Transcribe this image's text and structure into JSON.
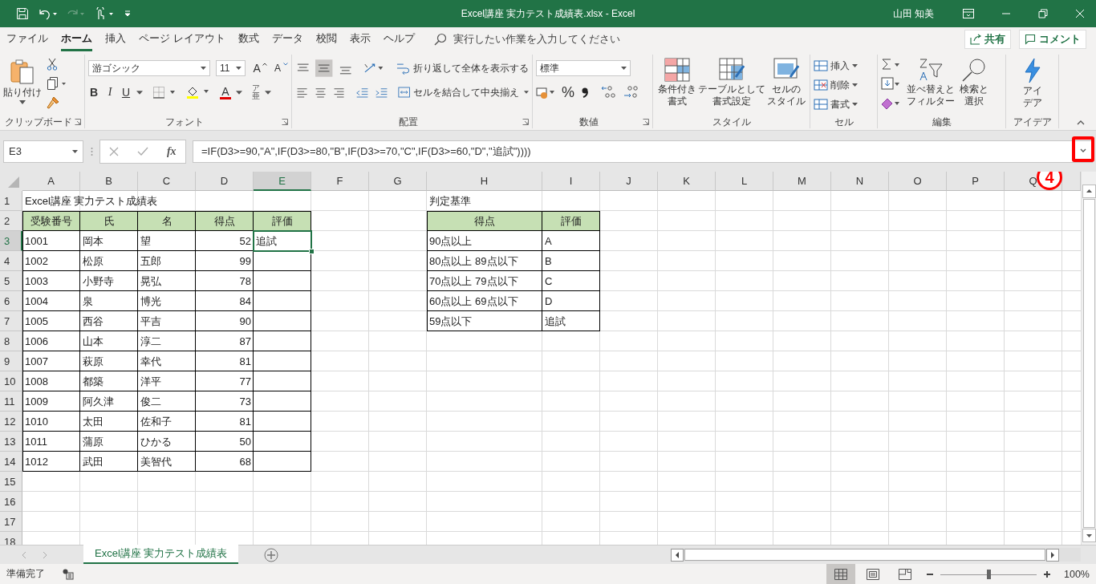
{
  "title_bar": {
    "title": "Excel講座 実力テスト成績表.xlsx  -  Excel",
    "user": "山田 知美"
  },
  "menu": {
    "tabs": [
      {
        "label": "ファイル",
        "selected": false
      },
      {
        "label": "ホーム",
        "selected": true
      },
      {
        "label": "挿入",
        "selected": false
      },
      {
        "label": "ページ レイアウト",
        "selected": false
      },
      {
        "label": "数式",
        "selected": false
      },
      {
        "label": "データ",
        "selected": false
      },
      {
        "label": "校閲",
        "selected": false
      },
      {
        "label": "表示",
        "selected": false
      },
      {
        "label": "ヘルプ",
        "selected": false
      }
    ],
    "search": {
      "placeholder": "実行したい作業を入力してください"
    },
    "share": "共有",
    "comment": "コメント"
  },
  "ribbon": {
    "clipboard": {
      "paste": "貼り付け",
      "label": "クリップボード"
    },
    "font": {
      "name": "游ゴシック",
      "size": "11",
      "grow": "A",
      "shrink": "A",
      "bold": "B",
      "italic": "I",
      "underline": "U",
      "font_color": "A",
      "phonetic": [
        "ア",
        "亜"
      ],
      "label": "フォント"
    },
    "alignment": {
      "wrap": "折り返して全体を表示する",
      "merge": "セルを結合して中央揃え",
      "label": "配置"
    },
    "number": {
      "format": "標準",
      "percent": "%",
      "label": "数値"
    },
    "styles": {
      "buttons": [
        {
          "lines": [
            "条件付き",
            "書式"
          ]
        },
        {
          "lines": [
            "テーブルとして",
            "書式設定"
          ]
        },
        {
          "lines": [
            "セルの",
            "スタイル"
          ]
        }
      ],
      "label": "スタイル"
    },
    "cells": {
      "buttons": [
        "挿入",
        "削除",
        "書式"
      ],
      "label": "セル"
    },
    "editing": {
      "buttons": [
        {
          "lines": [
            "並べ替えと",
            "フィルター"
          ]
        },
        {
          "lines": [
            "検索と",
            "選択"
          ]
        }
      ],
      "label": "編集"
    },
    "ideas": {
      "lines": [
        "アイ",
        "デア"
      ],
      "label": "アイデア"
    }
  },
  "formula_bar": {
    "name_box": "E3",
    "fx": "fx",
    "formula": "=IF(D3>=90,\"A\",IF(D3>=80,\"B\",IF(D3>=70,\"C\",IF(D3>=60,\"D\",\"追試\"))))"
  },
  "annotation": {
    "label": "4"
  },
  "sheet": {
    "columns": [
      {
        "label": "A",
        "selected": false
      },
      {
        "label": "B",
        "selected": false
      },
      {
        "label": "C",
        "selected": false
      },
      {
        "label": "D",
        "selected": false
      },
      {
        "label": "E",
        "selected": true
      },
      {
        "label": "F",
        "selected": false
      },
      {
        "label": "G",
        "selected": false
      },
      {
        "label": "H",
        "selected": false
      },
      {
        "label": "I",
        "selected": false
      },
      {
        "label": "J",
        "selected": false
      },
      {
        "label": "K",
        "selected": false
      },
      {
        "label": "L",
        "selected": false
      },
      {
        "label": "M",
        "selected": false
      },
      {
        "label": "N",
        "selected": false
      },
      {
        "label": "O",
        "selected": false
      },
      {
        "label": "P",
        "selected": false
      },
      {
        "label": "Q",
        "selected": false
      }
    ],
    "rows": [
      {
        "label": "1",
        "selected": false
      },
      {
        "label": "2",
        "selected": false
      },
      {
        "label": "3",
        "selected": true
      },
      {
        "label": "4",
        "selected": false
      },
      {
        "label": "5",
        "selected": false
      },
      {
        "label": "6",
        "selected": false
      },
      {
        "label": "7",
        "selected": false
      },
      {
        "label": "8",
        "selected": false
      },
      {
        "label": "9",
        "selected": false
      },
      {
        "label": "10",
        "selected": false
      },
      {
        "label": "11",
        "selected": false
      },
      {
        "label": "12",
        "selected": false
      },
      {
        "label": "13",
        "selected": false
      },
      {
        "label": "14",
        "selected": false
      },
      {
        "label": "15",
        "selected": false
      },
      {
        "label": "16",
        "selected": false
      },
      {
        "label": "17",
        "selected": false
      },
      {
        "label": "18",
        "selected": false
      }
    ],
    "title": "Excel講座 実力テスト成績表",
    "score_table": {
      "header": [
        "受験番号",
        "氏",
        "名",
        "得点",
        "評価"
      ],
      "rows": [
        [
          "1001",
          "岡本",
          "望",
          "52",
          "追試"
        ],
        [
          "1002",
          "松原",
          "五郎",
          "99"
        ],
        [
          "1003",
          "小野寺",
          "晃弘",
          "78"
        ],
        [
          "1004",
          "泉",
          "博光",
          "84"
        ],
        [
          "1005",
          "西谷",
          "平吉",
          "90"
        ],
        [
          "1006",
          "山本",
          "淳二",
          "87"
        ],
        [
          "1007",
          "萩原",
          "幸代",
          "81"
        ],
        [
          "1008",
          "都築",
          "洋平",
          "77"
        ],
        [
          "1009",
          "阿久津",
          "俊二",
          "73"
        ],
        [
          "1010",
          "太田",
          "佐和子",
          "81"
        ],
        [
          "1011",
          "蒲原",
          "ひかる",
          "50"
        ],
        [
          "1012",
          "武田",
          "美智代",
          "68"
        ]
      ]
    },
    "criteria_title": "判定基準",
    "criteria_table": {
      "header": [
        "得点",
        "評価"
      ],
      "rows": [
        [
          "90点以上",
          "A"
        ],
        [
          "80点以上 89点以下",
          "B"
        ],
        [
          "70点以上 79点以下",
          "C"
        ],
        [
          "60点以上 69点以下",
          "D"
        ],
        [
          "59点以下",
          "追試"
        ]
      ]
    }
  },
  "sheet_tabs": [
    {
      "label": "Excel講座 実力テスト成績表",
      "selected": true
    }
  ],
  "status_bar": {
    "status": "準備完了",
    "views": [
      {
        "kind": "normal",
        "selected": true
      },
      {
        "kind": "layout",
        "selected": false
      },
      {
        "kind": "pagebreak",
        "selected": false
      }
    ],
    "zoom": {
      "level": 0.5,
      "reading": "100%"
    }
  }
}
